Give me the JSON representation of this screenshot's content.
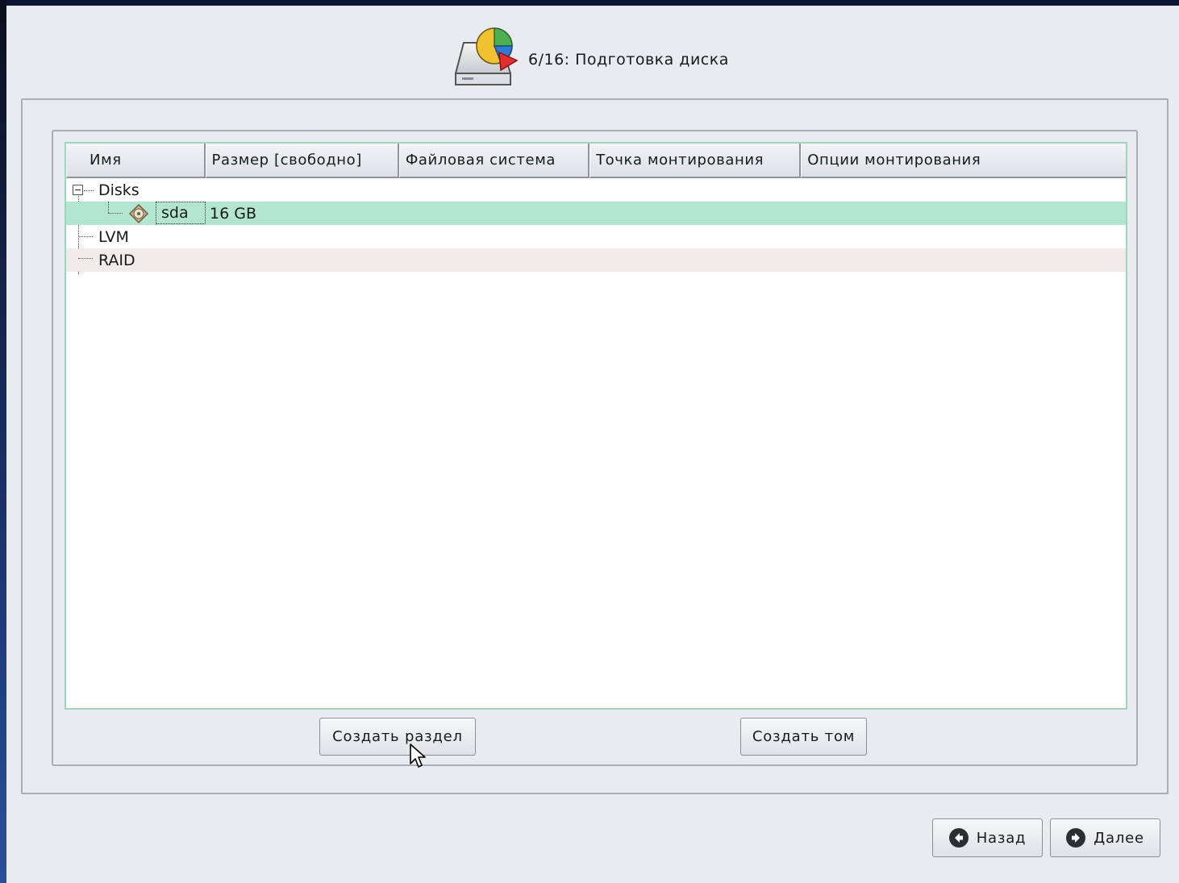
{
  "header": {
    "title": "6/16: Подготовка диска",
    "icon": "disk-partition-icon"
  },
  "tree": {
    "columns": [
      "Имя",
      "Размер [свободно]",
      "Файловая система",
      "Точка монтирования",
      "Опции монтирования"
    ],
    "rows": [
      {
        "name": "Disks",
        "size": "",
        "expander": "minus"
      },
      {
        "name": "sda",
        "size": "16 GB",
        "icon": "hard-disk-icon",
        "selected": true
      },
      {
        "name": "LVM",
        "size": ""
      },
      {
        "name": "RAID",
        "size": ""
      }
    ],
    "selection_color": "#b3e6d0"
  },
  "buttons": {
    "create_partition": "Создать раздел",
    "create_volume": "Создать том"
  },
  "nav": {
    "back": "Назад",
    "next": "Далее"
  }
}
